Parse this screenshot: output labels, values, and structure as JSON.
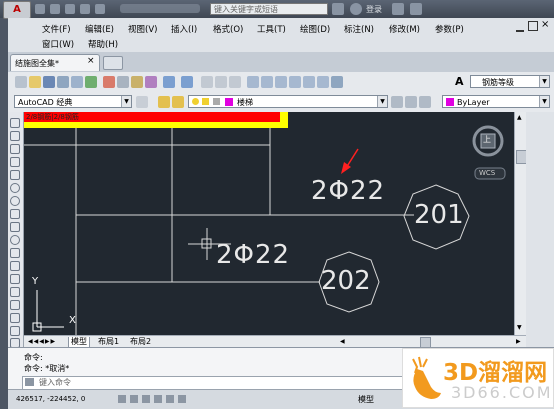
{
  "title_bar": {
    "search_placeholder": "键入关键字或短语",
    "signin": "登录"
  },
  "menu": {
    "row1": [
      "文件(F)",
      "编辑(E)",
      "视图(V)",
      "插入(I)",
      "格式(O)",
      "工具(T)",
      "绘图(D)",
      "标注(N)",
      "修改(M)",
      "参数(P)"
    ],
    "row2": [
      "窗口(W)",
      "帮助(H)"
    ]
  },
  "tabs": {
    "document": "结施图全集*",
    "close": "×"
  },
  "toolbar": {
    "textstyle_glyph": "A",
    "textstyle_value": "钢筋等级",
    "workspace_value": "AutoCAD 经典",
    "layer_value": "楼梯",
    "color_value": "ByLayer"
  },
  "drawing": {
    "label1": "2Φ22",
    "label2": "2Φ22",
    "circle1": "201",
    "circle2": "202",
    "ucs_x": "X",
    "ucs_y": "Y",
    "viewcube_face": "上",
    "wcs": "WCS",
    "redtext": "2/8钢筋|2/8钢筋"
  },
  "layout_tabs": [
    "模型",
    "布局1",
    "布局2"
  ],
  "command": {
    "line1": "命令:",
    "line2": "命令: *取消*",
    "prompt": "键入命令"
  },
  "status": {
    "coords": "426517, -224452, 0",
    "model": "模型"
  },
  "watermark": {
    "brand": "3D溜溜网",
    "url": "3D66.COM"
  }
}
